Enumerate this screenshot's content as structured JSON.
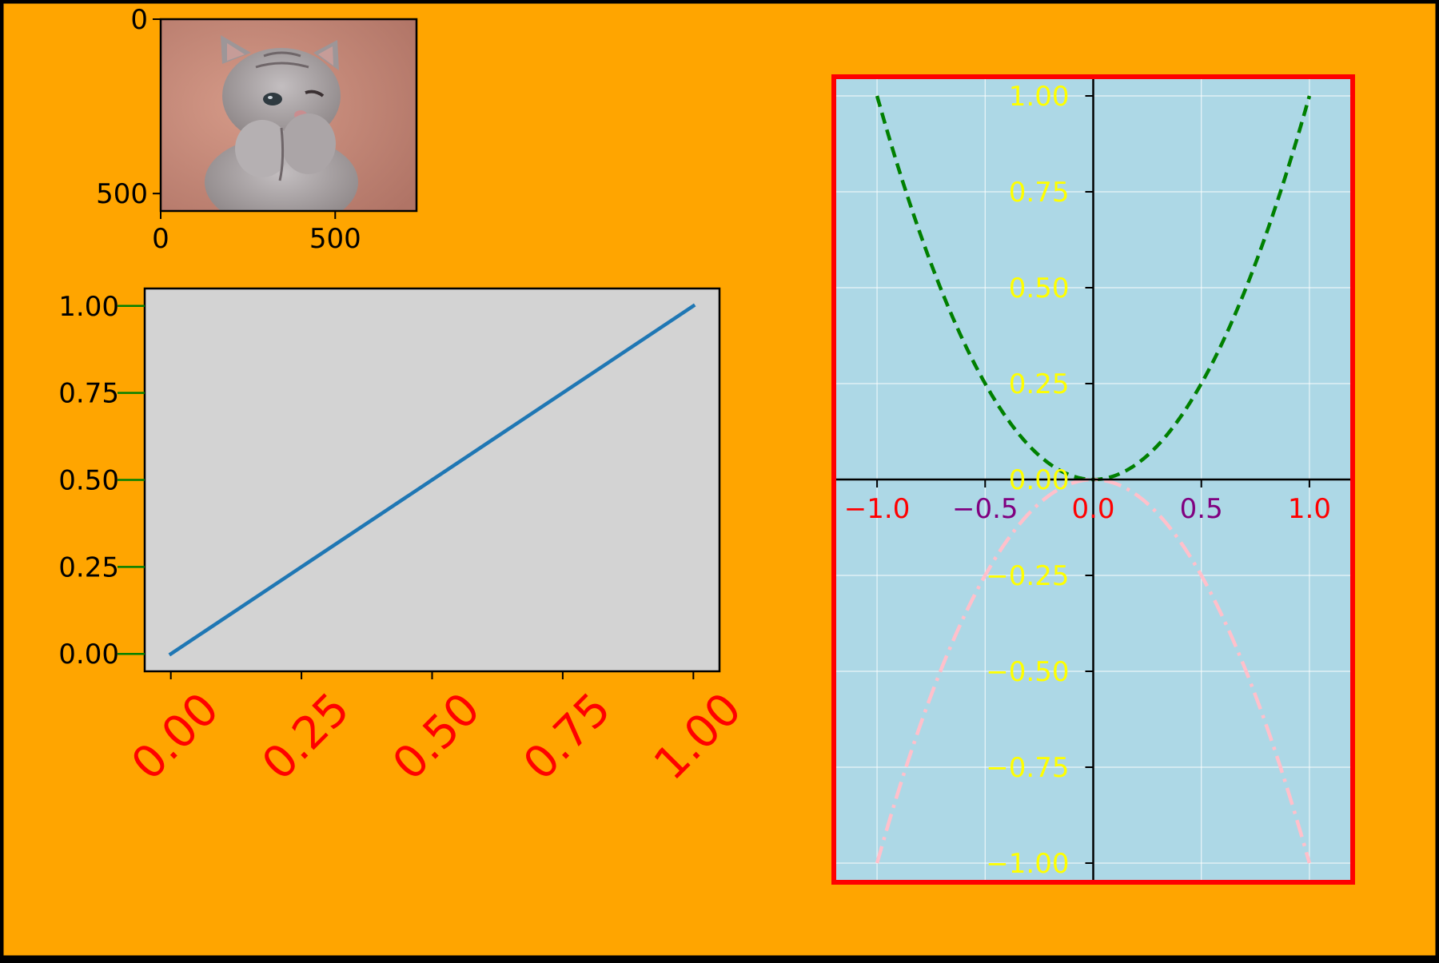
{
  "figure": {
    "background": "#ffa500",
    "border": "#000000"
  },
  "chart_data": [
    {
      "id": "image",
      "type": "image",
      "content": "photo of a grey tabby kitten winking, paws raised to its mouth, on a pink background",
      "x_ticks": [
        0,
        500
      ],
      "y_ticks": [
        0,
        500
      ],
      "x_tick_labels": [
        "0",
        "500"
      ],
      "y_tick_labels": [
        "0",
        "500"
      ],
      "xlim": [
        0,
        733
      ],
      "ylim": [
        550,
        0
      ],
      "colors": {
        "background": "#c88878",
        "fur": "#a7a2a4",
        "fur_dark": "#6f6669"
      }
    },
    {
      "id": "linear",
      "type": "line",
      "series": [
        {
          "x": [
            0,
            1
          ],
          "y": [
            0,
            1
          ],
          "color": "#1f77b4"
        }
      ],
      "xlim": [
        -0.05,
        1.05
      ],
      "ylim": [
        -0.05,
        1.05
      ],
      "x_ticks": [
        0,
        0.25,
        0.5,
        0.75,
        1
      ],
      "y_ticks": [
        0,
        0.25,
        0.5,
        0.75,
        1
      ],
      "x_tick_labels": [
        "0.00",
        "0.25",
        "0.50",
        "0.75",
        "1.00"
      ],
      "y_tick_labels": [
        "0.00",
        "0.25",
        "0.50",
        "0.75",
        "1.00"
      ],
      "x_tick_label_color": "#ff0000",
      "x_tick_label_rotation": 45,
      "y_tick_color": "#008000",
      "axes_facecolor": "#d3d3d3",
      "grid": false
    },
    {
      "id": "parabolas",
      "type": "line",
      "series": [
        {
          "expression": "y = x^2",
          "x": [
            -1,
            -0.9,
            -0.8,
            -0.7,
            -0.6,
            -0.5,
            -0.4,
            -0.3,
            -0.2,
            -0.1,
            0,
            0.1,
            0.2,
            0.3,
            0.4,
            0.5,
            0.6,
            0.7,
            0.8,
            0.9,
            1
          ],
          "y": [
            1,
            0.81,
            0.64,
            0.49,
            0.36,
            0.25,
            0.16,
            0.09,
            0.04,
            0.01,
            0,
            0.01,
            0.04,
            0.09,
            0.16,
            0.25,
            0.36,
            0.49,
            0.64,
            0.81,
            1
          ],
          "color": "#008000",
          "style": "dashed"
        },
        {
          "expression": "y = -x^2",
          "x": [
            -1,
            -0.9,
            -0.8,
            -0.7,
            -0.6,
            -0.5,
            -0.4,
            -0.3,
            -0.2,
            -0.1,
            0,
            0.1,
            0.2,
            0.3,
            0.4,
            0.5,
            0.6,
            0.7,
            0.8,
            0.9,
            1
          ],
          "y": [
            -1,
            -0.81,
            -0.64,
            -0.49,
            -0.36,
            -0.25,
            -0.16,
            -0.09,
            -0.04,
            -0.01,
            0,
            -0.01,
            -0.04,
            -0.09,
            -0.16,
            -0.25,
            -0.36,
            -0.49,
            -0.64,
            -0.81,
            -1
          ],
          "color": "#ffc0cb",
          "style": "dashdot"
        }
      ],
      "xlim": [
        -1.2,
        1.2
      ],
      "ylim": [
        -1.05,
        1.05
      ],
      "x_ticks": [
        -1,
        -0.5,
        0,
        0.5,
        1
      ],
      "x_tick_labels": [
        "−1.0",
        "−0.5",
        "0.0",
        "0.5",
        "1.0"
      ],
      "x_tick_label_colors": [
        "#ff0000",
        "#800080",
        "#ff0000",
        "#800080",
        "#ff0000"
      ],
      "y_ticks": [
        -1,
        -0.75,
        -0.5,
        -0.25,
        0,
        0.25,
        0.5,
        0.75,
        1
      ],
      "y_tick_labels": [
        "−1.00",
        "−0.75",
        "−0.50",
        "−0.25",
        "0.00",
        "0.25",
        "0.50",
        "0.75",
        "1.00"
      ],
      "y_tick_label_color": "#ffff00",
      "spines": "centered",
      "axes_facecolor": "#add8e6",
      "axes_border_color": "#ff0000",
      "grid": true,
      "grid_color": "#ffffff"
    }
  ]
}
